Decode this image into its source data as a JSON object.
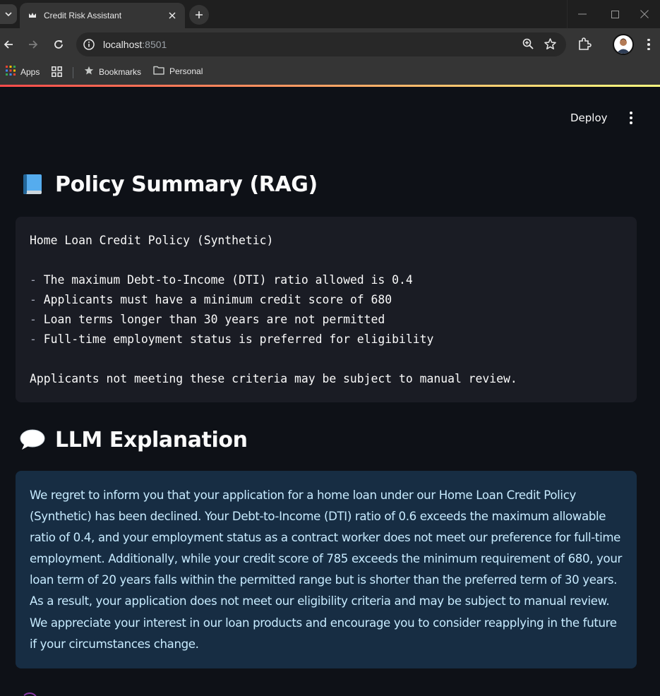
{
  "browser": {
    "tab_title": "Credit Risk Assistant",
    "url_host": "localhost",
    "url_port": ":8501",
    "bookmarks": {
      "apps_label": "Apps",
      "bookmarks_label": "Bookmarks",
      "personal_label": "Personal"
    }
  },
  "header": {
    "deploy_label": "Deploy"
  },
  "policy": {
    "heading": "Policy Summary (RAG)",
    "heading_icon": "blue-book-icon",
    "title": "Home Loan Credit Policy (Synthetic)",
    "rules": [
      "The maximum Debt-to-Income (DTI) ratio allowed is 0.4",
      "Applicants must have a minimum credit score of 680",
      "Loan terms longer than 30 years are not permitted",
      "Full-time employment status is preferred for eligibility"
    ],
    "footer": "Applicants not meeting these criteria may be subject to manual review."
  },
  "llm": {
    "heading": "LLM Explanation",
    "heading_icon": "speech-balloon-icon",
    "explanation": "We regret to inform you that your application for a home loan under our Home Loan Credit Policy (Synthetic) has been declined. Your Debt-to-Income (DTI) ratio of 0.6 exceeds the maximum allowable ratio of 0.4, and your employment status as a contract worker does not meet our preference for full-time employment. Additionally, while your credit score of 785 exceeds the minimum requirement of 680, your loan term of 20 years falls within the permitted range but is shorter than the preferred term of 30 years. As a result, your application does not meet our eligibility criteria and may be subject to manual review. We appreciate your interest in our loan products and encourage you to consider reapplying in the future if your circumstances change."
  },
  "colors": {
    "app_background": "#0e1117",
    "code_background": "#1a1c24",
    "info_background": "#172d43",
    "info_text": "#c7ebff"
  }
}
